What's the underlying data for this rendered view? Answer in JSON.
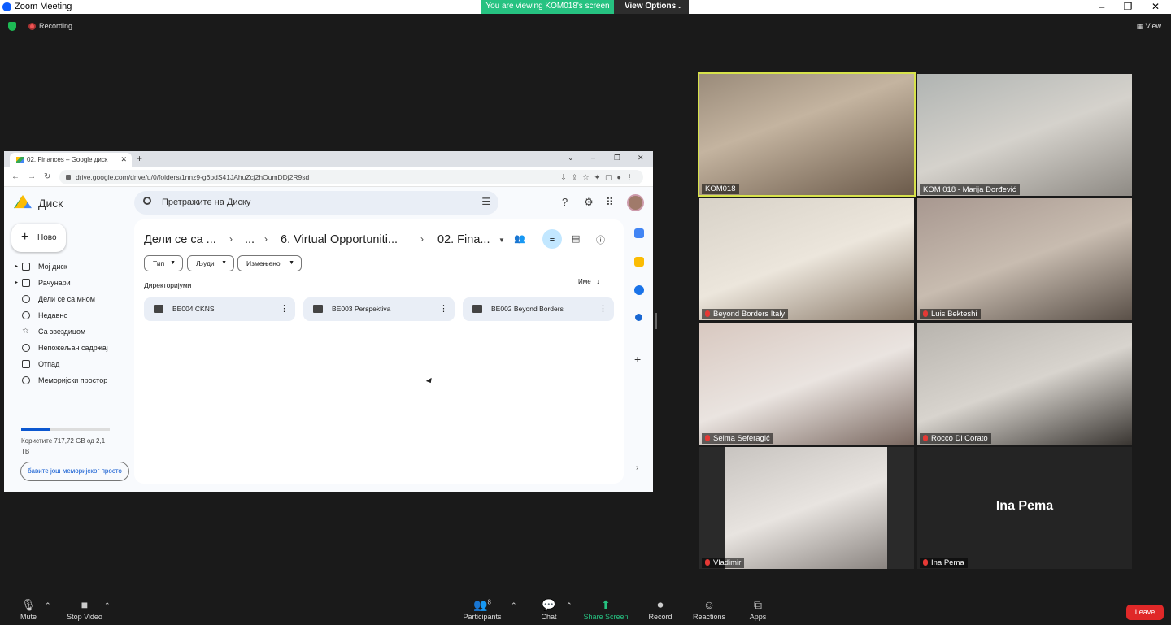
{
  "window": {
    "title": "Zoom Meeting",
    "viewing_banner": "You are viewing KOM018's screen",
    "view_options": "View Options",
    "view_label": "View"
  },
  "status": {
    "recording": "Recording"
  },
  "browser": {
    "tab_title": "02. Finances – Google диск",
    "url": "drive.google.com/drive/u/0/folders/1nnz9-g6pdS41JAhuZcj2hOumDDj2R9sd"
  },
  "drive": {
    "app_name": "Диск",
    "search_placeholder": "Претражите на Диску",
    "new_button": "Ново",
    "nav": [
      "Мој диск",
      "Рачунари",
      "Дели се са мном",
      "Недавно",
      "Са звездицом",
      "Непожељан садржај",
      "Отпад",
      "Меморијски простор"
    ],
    "storage_text": "Користите 717,72 GB од 2,1 TB",
    "storage_fraction": 0.33,
    "get_more": "бавите још меморијског просто",
    "breadcrumb": [
      "Дели се са ...",
      "...",
      "6. Virtual Opportuniti...",
      "02. Fina..."
    ],
    "filters": [
      "Тип",
      "Људи",
      "Измењено"
    ],
    "section": "Директоријуми",
    "sort_label": "Име",
    "folders": [
      "BE004 CKNS",
      "BE003 Perspektiva",
      "BE002 Beyond Borders"
    ]
  },
  "participants": [
    {
      "name": "KOM018",
      "active": true
    },
    {
      "name": "KOM 018 - Marija Đorđević"
    },
    {
      "name": "Beyond Borders Italy"
    },
    {
      "name": "Luis Bekteshi"
    },
    {
      "name": "Selma Seferagić"
    },
    {
      "name": "Rocco Di Corato"
    },
    {
      "name": "Vladimir"
    },
    {
      "name": "Ina Pema",
      "video_off_label": "Ina Pema"
    }
  ],
  "toolbar": {
    "mute": "Mute",
    "stop_video": "Stop Video",
    "participants": "Participants",
    "participants_count": "8",
    "chat": "Chat",
    "share_screen": "Share Screen",
    "record": "Record",
    "reactions": "Reactions",
    "apps": "Apps",
    "leave": "Leave"
  }
}
